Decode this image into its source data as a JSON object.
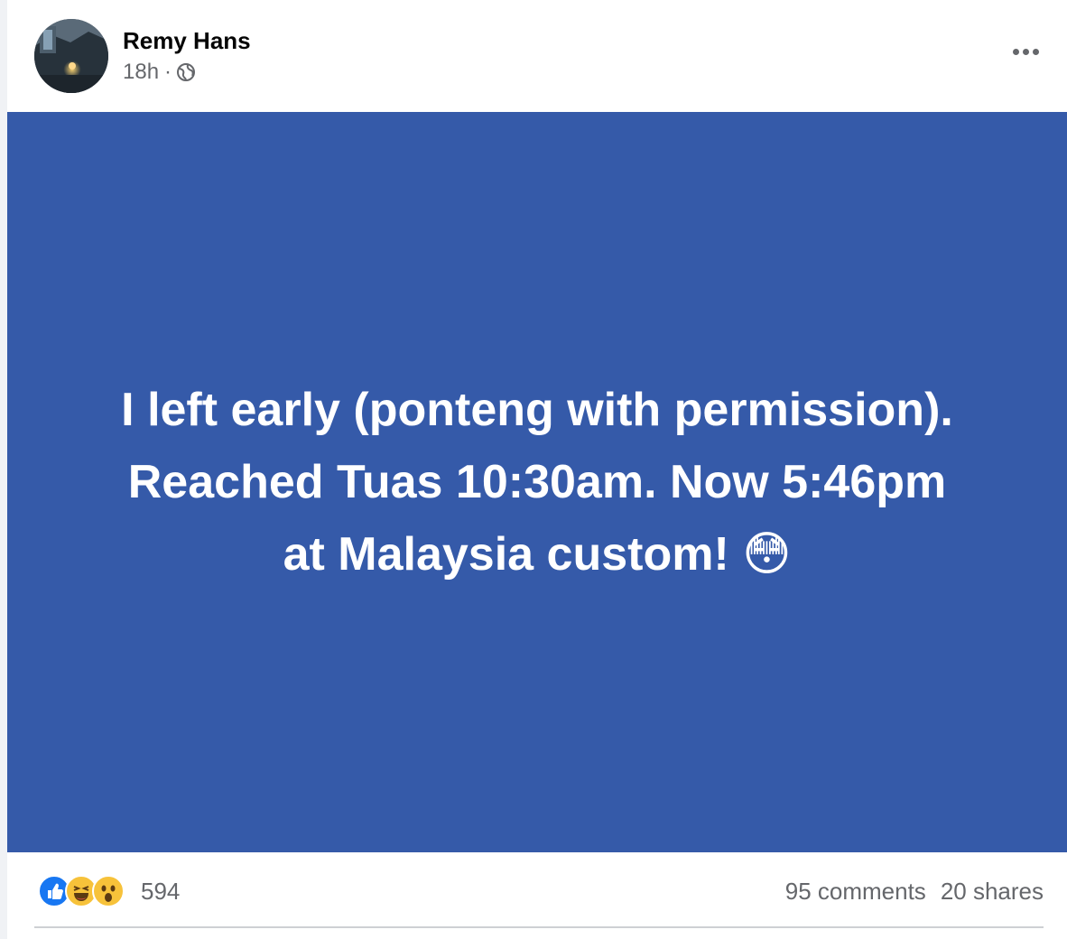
{
  "post": {
    "author_name": "Remy Hans",
    "timestamp": "18h",
    "meta_separator": "·",
    "audience_icon": "globe-icon",
    "more_icon": "more-options-icon",
    "text_line1": "I left early (ponteng with permission).",
    "text_line2": "Reached Tuas 10:30am. Now 5:46pm",
    "text_line3": "at Malaysia custom! 😳",
    "background_color": "#355aa9"
  },
  "footer": {
    "reaction_icons": [
      "like-icon",
      "haha-icon",
      "wow-icon"
    ],
    "reaction_count": "594",
    "comments": "95 comments",
    "shares": "20 shares"
  }
}
